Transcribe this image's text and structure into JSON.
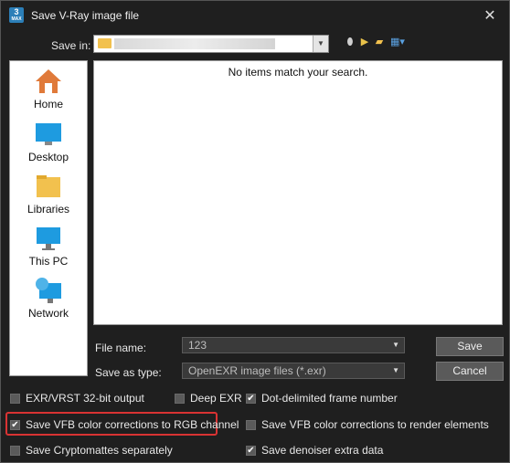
{
  "window": {
    "title": "Save V-Ray image file",
    "app_icon_text": "3",
    "app_icon_sub": "MAX",
    "close_glyph": "✕"
  },
  "toolbar": {
    "save_in_label": "Save in:",
    "save_in_value": "",
    "tools": [
      "back-icon",
      "up-folder-icon",
      "new-folder-icon",
      "view-menu-icon"
    ]
  },
  "places": [
    {
      "label": "Home",
      "icon": "home-icon"
    },
    {
      "label": "Desktop",
      "icon": "desktop-icon"
    },
    {
      "label": "Libraries",
      "icon": "libraries-icon"
    },
    {
      "label": "This PC",
      "icon": "this-pc-icon"
    },
    {
      "label": "Network",
      "icon": "network-icon"
    }
  ],
  "file_list": {
    "empty_message": "No items match your search."
  },
  "form": {
    "file_name_label": "File name:",
    "file_name_value": "123",
    "save_as_type_label": "Save as type:",
    "save_as_type_value": "OpenEXR image files (*.exr)"
  },
  "buttons": {
    "save": "Save",
    "cancel": "Cancel"
  },
  "options": [
    {
      "label": "EXR/VRST 32-bit output",
      "checked": false
    },
    {
      "label": "Deep EXR",
      "checked": false
    },
    {
      "label": "Dot-delimited frame number",
      "checked": true
    },
    {
      "label": "Save VFB color corrections to RGB channel",
      "checked": true
    },
    {
      "label": "Save VFB color corrections to render elements",
      "checked": false
    },
    {
      "label": "Save Cryptomattes separately",
      "checked": false
    },
    {
      "label": "Save denoiser extra data",
      "checked": true
    }
  ],
  "colors": {
    "highlight": "#d93333",
    "background": "#1f1f1f"
  }
}
